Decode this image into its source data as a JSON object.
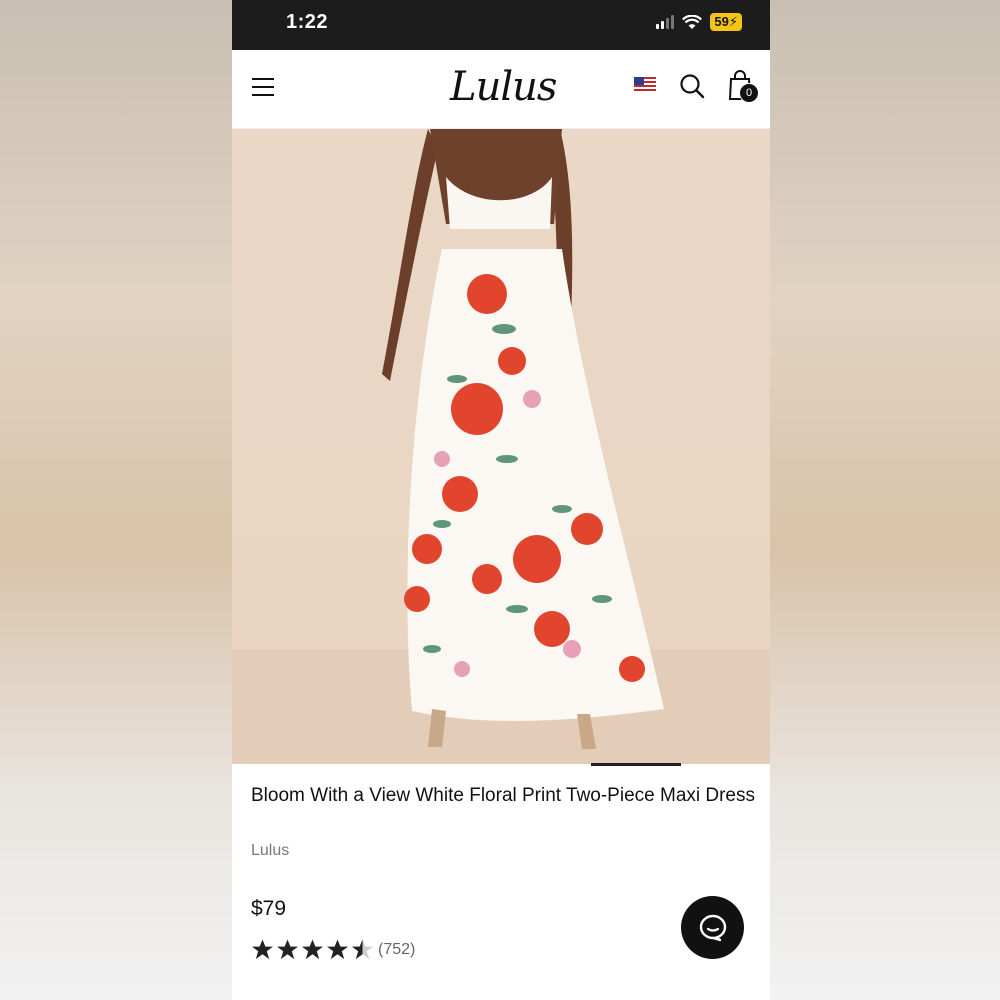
{
  "status_bar": {
    "time": "1:22",
    "battery": "59"
  },
  "header": {
    "logo": "Lulus",
    "cart_count": "0"
  },
  "product": {
    "title": "Bloom With a View White Floral Print Two-Piece Maxi Dress",
    "brand": "Lulus",
    "price": "$79",
    "rating": 4.5,
    "review_count": "(752)"
  },
  "icons": {
    "menu": "hamburger-menu-icon",
    "flag": "us-flag-icon",
    "search": "search-icon",
    "cart": "shopping-bag-icon",
    "chat": "chat-icon"
  },
  "colors": {
    "header_bg": "#ffffff",
    "status_bg": "#1c1c1c",
    "battery": "#f2c518",
    "text": "#111111"
  }
}
